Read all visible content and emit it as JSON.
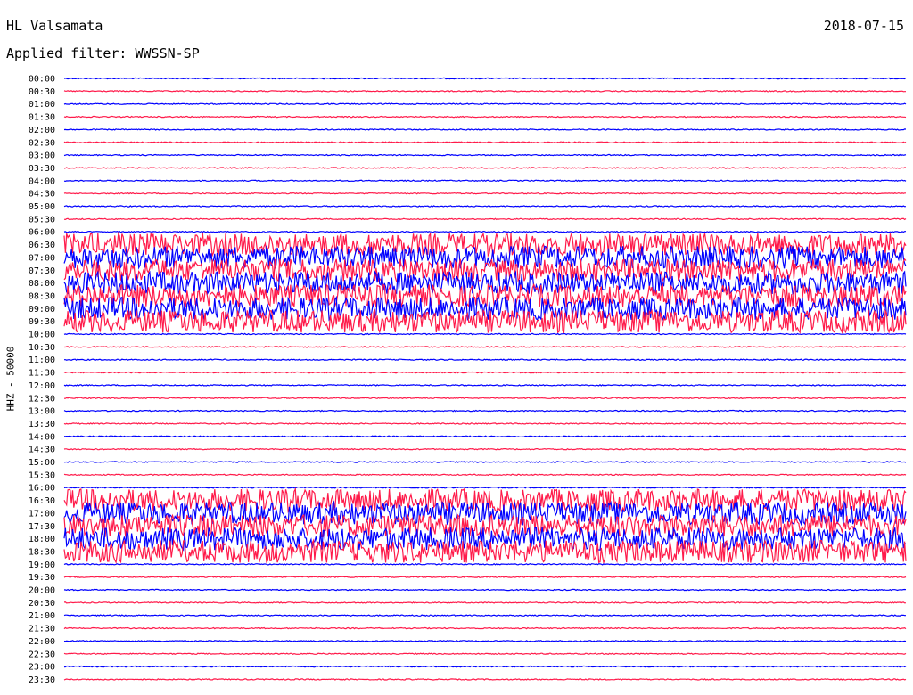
{
  "header": {
    "station": "HL Valsamata",
    "date": "2018-07-15",
    "filter": "Applied filter: WWSSN-SP"
  },
  "chart_data": {
    "type": "line",
    "title": "HL Valsamata",
    "subtitle": "Applied filter: WWSSN-SP",
    "ylabel": "HHZ - 50000",
    "date": "2018-07-15",
    "rows": [
      "00:00",
      "00:30",
      "01:00",
      "01:30",
      "02:00",
      "02:30",
      "03:00",
      "03:30",
      "04:00",
      "04:30",
      "05:00",
      "05:30",
      "06:00",
      "06:30",
      "07:00",
      "07:30",
      "08:00",
      "08:30",
      "09:00",
      "09:30",
      "10:00",
      "10:30",
      "11:00",
      "11:30",
      "12:00",
      "12:30",
      "13:00",
      "13:30",
      "14:00",
      "14:30",
      "15:00",
      "15:30",
      "16:00",
      "16:30",
      "17:00",
      "17:30",
      "18:00",
      "18:30",
      "19:00",
      "19:30",
      "20:00",
      "20:30",
      "21:00",
      "21:30",
      "22:00",
      "22:30",
      "23:00",
      "23:30"
    ],
    "row_minutes": 30,
    "series_colors": [
      "#0000ff",
      "#ff1a4a"
    ],
    "noise_bands": [
      {
        "rows": [
          13,
          19
        ],
        "start_min": 0,
        "end_min": 30,
        "level": 0.9
      },
      {
        "rows": [
          33,
          37
        ],
        "start_min": 0,
        "end_min": 30,
        "level": 0.9
      }
    ],
    "events": [
      {
        "row": 0,
        "minute": 6.9,
        "amp": 0.2
      },
      {
        "row": 1,
        "minute": 6.5,
        "amp": 0.2
      },
      {
        "row": 2,
        "minute": 6.2,
        "amp": 0.5
      },
      {
        "row": 3,
        "minute": 24.3,
        "amp": 0.6
      },
      {
        "row": 4,
        "minute": 20.5,
        "amp": 0.7
      },
      {
        "row": 5,
        "minute": 15.6,
        "amp": 0.6
      },
      {
        "row": 5,
        "minute": 19.2,
        "amp": 0.6
      },
      {
        "row": 7,
        "minute": 9.4,
        "amp": 2.5
      },
      {
        "row": 9,
        "minute": 9.5,
        "amp": 1.0
      },
      {
        "row": 9,
        "minute": 18.4,
        "amp": 1.4
      },
      {
        "row": 10,
        "minute": 3.7,
        "amp": 0.3
      },
      {
        "row": 11,
        "minute": 29.0,
        "amp": 0.6
      },
      {
        "row": 18,
        "minute": 15.0,
        "amp": 10
      },
      {
        "row": 20,
        "minute": 23.9,
        "amp": 1.2
      },
      {
        "row": 23,
        "minute": 29.3,
        "amp": 1.0
      },
      {
        "row": 26,
        "minute": 6.6,
        "amp": 0.8
      },
      {
        "row": 27,
        "minute": 0.8,
        "amp": 1.0
      },
      {
        "row": 28,
        "minute": 17.2,
        "amp": 1.3
      },
      {
        "row": 29,
        "minute": 7.0,
        "amp": 1.0
      },
      {
        "row": 33,
        "minute": 24.5,
        "amp": 0.6
      },
      {
        "row": 38,
        "minute": 10.0,
        "amp": 2.0
      },
      {
        "row": 41,
        "minute": 23.5,
        "amp": 1.4
      },
      {
        "row": 43,
        "minute": 1.3,
        "amp": 1.8
      },
      {
        "row": 45,
        "minute": 10.0,
        "amp": 2.8
      },
      {
        "row": 47,
        "minute": 2.8,
        "amp": 0.5
      }
    ]
  }
}
